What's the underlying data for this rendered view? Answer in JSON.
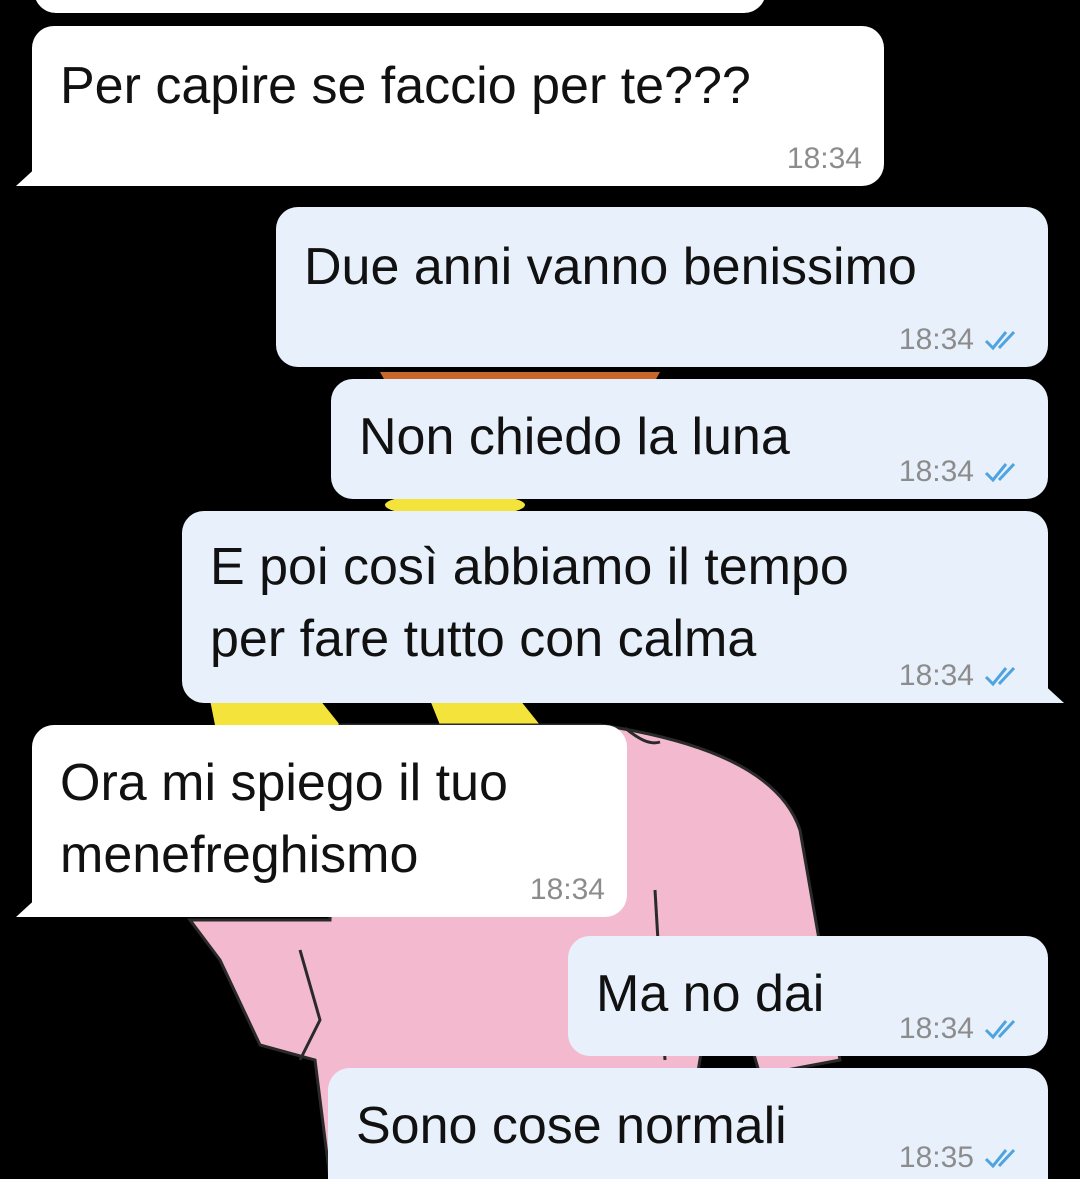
{
  "conversation": {
    "messages": [
      {
        "direction": "incoming",
        "text": "Per capire se faccio per te???",
        "time": "18:34"
      },
      {
        "direction": "outgoing",
        "text": "Due anni vanno benissimo",
        "time": "18:34",
        "status": "read"
      },
      {
        "direction": "outgoing",
        "text": "Non chiedo la luna",
        "time": "18:34",
        "status": "read"
      },
      {
        "direction": "outgoing",
        "text": "E poi così abbiamo il tempo\nper fare tutto con calma",
        "time": "18:34",
        "status": "read"
      },
      {
        "direction": "incoming",
        "text": "Ora mi spiego il tuo\nmenefreghismo",
        "time": "18:34"
      },
      {
        "direction": "outgoing",
        "text": "Ma no dai",
        "time": "18:34",
        "status": "read"
      },
      {
        "direction": "outgoing",
        "text": "Sono cose normali",
        "time": "18:35",
        "status": "read"
      }
    ]
  },
  "colors": {
    "background": "#000000",
    "incoming_bubble": "#ffffff",
    "outgoing_bubble": "#e8f1fb",
    "read_ticks": "#4fa3e0",
    "timestamp": "#8c8c8c"
  }
}
